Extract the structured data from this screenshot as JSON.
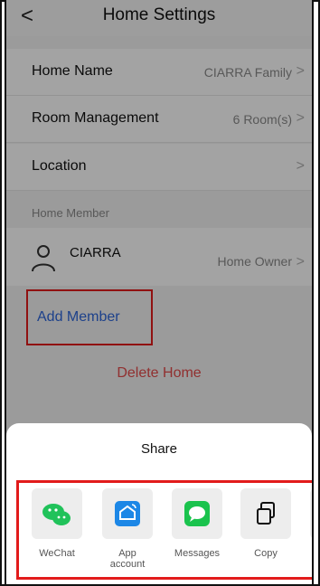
{
  "header": {
    "back": "<",
    "title": "Home Settings"
  },
  "rows": [
    {
      "label": "Home Name",
      "value": "CIARRA Family"
    },
    {
      "label": "Room Management",
      "value": "6 Room(s)"
    },
    {
      "label": "Location",
      "value": ""
    }
  ],
  "section_title": "Home Member",
  "member": {
    "name": "CIARRA",
    "role": "Home Owner"
  },
  "add_member": "Add Member",
  "delete_home": "Delete Home",
  "share": {
    "title": "Share",
    "items": [
      {
        "label": "WeChat",
        "icon": "wechat-icon",
        "color": "#20c25a"
      },
      {
        "label": "App\naccount",
        "icon": "app-account-icon",
        "color": "#1c87e6"
      },
      {
        "label": "Messages",
        "icon": "messages-icon",
        "color": "#1ac34d"
      },
      {
        "label": "Copy",
        "icon": "copy-icon",
        "color": "#111111"
      }
    ]
  },
  "chevron": ">",
  "colors": {
    "highlight": "#e21b1b",
    "link": "#2e66d9",
    "danger": "#e34b4b"
  }
}
